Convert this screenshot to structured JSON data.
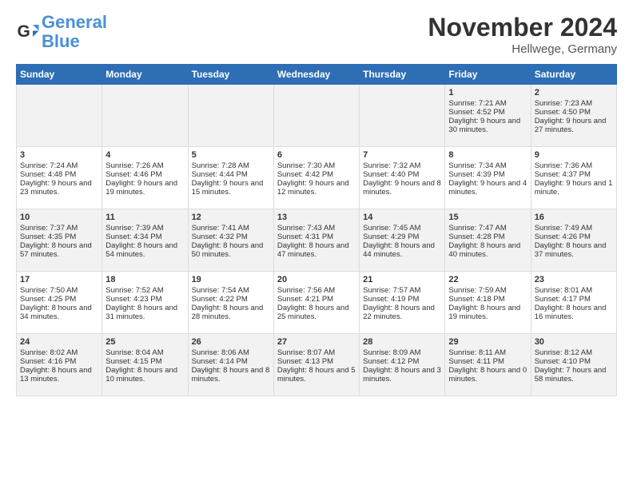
{
  "logo": {
    "line1": "General",
    "line2": "Blue"
  },
  "title": "November 2024",
  "subtitle": "Hellwege, Germany",
  "header_days": [
    "Sunday",
    "Monday",
    "Tuesday",
    "Wednesday",
    "Thursday",
    "Friday",
    "Saturday"
  ],
  "weeks": [
    [
      {
        "day": "",
        "content": ""
      },
      {
        "day": "",
        "content": ""
      },
      {
        "day": "",
        "content": ""
      },
      {
        "day": "",
        "content": ""
      },
      {
        "day": "",
        "content": ""
      },
      {
        "day": "1",
        "content": "Sunrise: 7:21 AM\nSunset: 4:52 PM\nDaylight: 9 hours and 30 minutes."
      },
      {
        "day": "2",
        "content": "Sunrise: 7:23 AM\nSunset: 4:50 PM\nDaylight: 9 hours and 27 minutes."
      }
    ],
    [
      {
        "day": "3",
        "content": "Sunrise: 7:24 AM\nSunset: 4:48 PM\nDaylight: 9 hours and 23 minutes."
      },
      {
        "day": "4",
        "content": "Sunrise: 7:26 AM\nSunset: 4:46 PM\nDaylight: 9 hours and 19 minutes."
      },
      {
        "day": "5",
        "content": "Sunrise: 7:28 AM\nSunset: 4:44 PM\nDaylight: 9 hours and 15 minutes."
      },
      {
        "day": "6",
        "content": "Sunrise: 7:30 AM\nSunset: 4:42 PM\nDaylight: 9 hours and 12 minutes."
      },
      {
        "day": "7",
        "content": "Sunrise: 7:32 AM\nSunset: 4:40 PM\nDaylight: 9 hours and 8 minutes."
      },
      {
        "day": "8",
        "content": "Sunrise: 7:34 AM\nSunset: 4:39 PM\nDaylight: 9 hours and 4 minutes."
      },
      {
        "day": "9",
        "content": "Sunrise: 7:36 AM\nSunset: 4:37 PM\nDaylight: 9 hours and 1 minute."
      }
    ],
    [
      {
        "day": "10",
        "content": "Sunrise: 7:37 AM\nSunset: 4:35 PM\nDaylight: 8 hours and 57 minutes."
      },
      {
        "day": "11",
        "content": "Sunrise: 7:39 AM\nSunset: 4:34 PM\nDaylight: 8 hours and 54 minutes."
      },
      {
        "day": "12",
        "content": "Sunrise: 7:41 AM\nSunset: 4:32 PM\nDaylight: 8 hours and 50 minutes."
      },
      {
        "day": "13",
        "content": "Sunrise: 7:43 AM\nSunset: 4:31 PM\nDaylight: 8 hours and 47 minutes."
      },
      {
        "day": "14",
        "content": "Sunrise: 7:45 AM\nSunset: 4:29 PM\nDaylight: 8 hours and 44 minutes."
      },
      {
        "day": "15",
        "content": "Sunrise: 7:47 AM\nSunset: 4:28 PM\nDaylight: 8 hours and 40 minutes."
      },
      {
        "day": "16",
        "content": "Sunrise: 7:49 AM\nSunset: 4:26 PM\nDaylight: 8 hours and 37 minutes."
      }
    ],
    [
      {
        "day": "17",
        "content": "Sunrise: 7:50 AM\nSunset: 4:25 PM\nDaylight: 8 hours and 34 minutes."
      },
      {
        "day": "18",
        "content": "Sunrise: 7:52 AM\nSunset: 4:23 PM\nDaylight: 8 hours and 31 minutes."
      },
      {
        "day": "19",
        "content": "Sunrise: 7:54 AM\nSunset: 4:22 PM\nDaylight: 8 hours and 28 minutes."
      },
      {
        "day": "20",
        "content": "Sunrise: 7:56 AM\nSunset: 4:21 PM\nDaylight: 8 hours and 25 minutes."
      },
      {
        "day": "21",
        "content": "Sunrise: 7:57 AM\nSunset: 4:19 PM\nDaylight: 8 hours and 22 minutes."
      },
      {
        "day": "22",
        "content": "Sunrise: 7:59 AM\nSunset: 4:18 PM\nDaylight: 8 hours and 19 minutes."
      },
      {
        "day": "23",
        "content": "Sunrise: 8:01 AM\nSunset: 4:17 PM\nDaylight: 8 hours and 16 minutes."
      }
    ],
    [
      {
        "day": "24",
        "content": "Sunrise: 8:02 AM\nSunset: 4:16 PM\nDaylight: 8 hours and 13 minutes."
      },
      {
        "day": "25",
        "content": "Sunrise: 8:04 AM\nSunset: 4:15 PM\nDaylight: 8 hours and 10 minutes."
      },
      {
        "day": "26",
        "content": "Sunrise: 8:06 AM\nSunset: 4:14 PM\nDaylight: 8 hours and 8 minutes."
      },
      {
        "day": "27",
        "content": "Sunrise: 8:07 AM\nSunset: 4:13 PM\nDaylight: 8 hours and 5 minutes."
      },
      {
        "day": "28",
        "content": "Sunrise: 8:09 AM\nSunset: 4:12 PM\nDaylight: 8 hours and 3 minutes."
      },
      {
        "day": "29",
        "content": "Sunrise: 8:11 AM\nSunset: 4:11 PM\nDaylight: 8 hours and 0 minutes."
      },
      {
        "day": "30",
        "content": "Sunrise: 8:12 AM\nSunset: 4:10 PM\nDaylight: 7 hours and 58 minutes."
      }
    ]
  ]
}
